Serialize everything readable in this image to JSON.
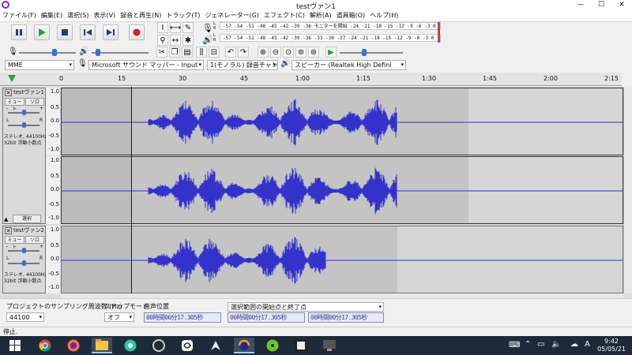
{
  "window": {
    "title": "testヴァン1",
    "minimize": "—",
    "maximize": "☐",
    "close": "✕"
  },
  "menu": [
    "ファイル(F)",
    "編集(E)",
    "選択(S)",
    "表示(V)",
    "録音と再生(N)",
    "トラック(T)",
    "ジェネレーター(G)",
    "エフェクト(C)",
    "解析(A)",
    "道具箱(O)",
    "ヘルプ(H)"
  ],
  "meters": {
    "record": "-57 -54 -51 -48 -45 -42 -39 -36 モニターを開始 -24 -21 -18 -15 -12 -9 -6 -3 0",
    "playback": "-57 -54 -51 -48 -45 -42 -39 -36 -33 -30 -27 -24 -21 -18 -15 -12 -9 -6 -3 0",
    "lr": [
      "L",
      "R"
    ]
  },
  "device": {
    "host": "MME",
    "input": "Microsoft サウンド マッパー - Input",
    "channels": "1(モノラル) 録音チャンネル",
    "output": "スピーカー (Realtek High Defini"
  },
  "ruler": {
    "ticks": [
      "0",
      "15",
      "30",
      "45",
      "1:00",
      "1:15",
      "1:30",
      "1:45",
      "2:00",
      "2:15"
    ]
  },
  "tracks": [
    {
      "name": "testヴァン1",
      "mute": "ミュート",
      "solo": "ソロ",
      "gain_minus": "-",
      "gain_plus": "+",
      "pan_l": "L",
      "pan_r": "R",
      "info1": "ステレオ, 44100Hz",
      "info2": "32bit 浮動小数点",
      "select": "選択",
      "scale": [
        "1.0",
        "0.5",
        "0.0",
        "-0.5",
        "-1.0"
      ]
    },
    {
      "name": "testヴァン2",
      "mute": "ミュート",
      "solo": "ソロ",
      "gain_minus": "-",
      "gain_plus": "+",
      "pan_l": "L",
      "pan_r": "R",
      "info1": "ステレオ, 44100Hz",
      "info2": "32bit 浮動小数点",
      "scale": [
        "1.0",
        "0.5",
        "0.0",
        "-0.5",
        "-1.0"
      ]
    }
  ],
  "selection_toolbar": {
    "rate_label": "プロジェクトのサンプリング周波数 (Hz)",
    "rate_value": "44100",
    "snap_label": "スナップモード",
    "snap_value": "オフ",
    "audio_pos_label": "音声位置",
    "audio_pos": "00時間00分17.305秒",
    "selection_mode": "選択範囲の開始点と終了点",
    "sel_start": "00時間00分17.305秒",
    "sel_end": "00時間00分17.305秒"
  },
  "status": "停止.",
  "taskbar": {
    "time": "9:42",
    "date": "05/05/21",
    "ime": "A"
  },
  "colors": {
    "waveform": "#3333cc",
    "accent": "#7b2ac4"
  }
}
